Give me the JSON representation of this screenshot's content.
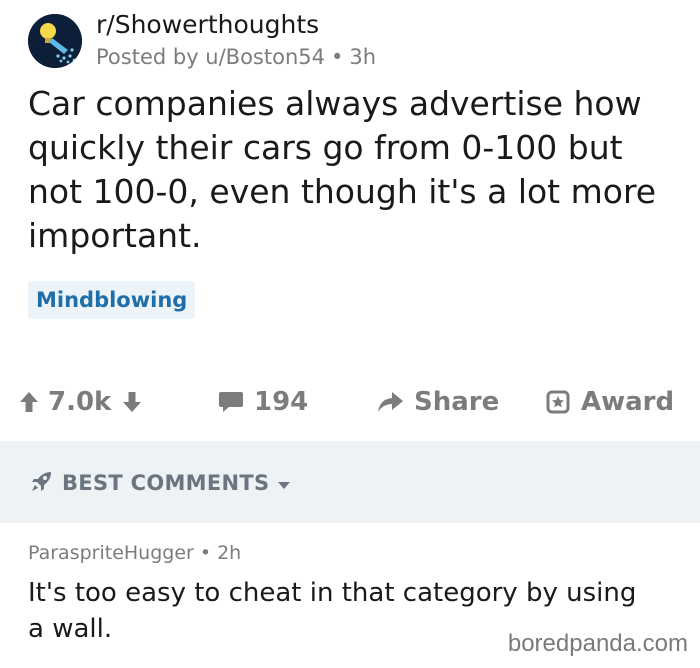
{
  "post": {
    "subreddit": "r/Showerthoughts",
    "posted_by": "Posted by u/Boston54",
    "separator": "•",
    "age": "3h",
    "title": "Car companies always advertise how quickly their cars go from 0-100 but not 100-0, even though it's a lot more important.",
    "flair": "Mindblowing",
    "avatar_icon": "lightbulb-shower-icon"
  },
  "actions": {
    "votes": "7.0k",
    "comments_count": "194",
    "share_label": "Share",
    "award_label": "Award"
  },
  "sort": {
    "label": "BEST COMMENTS"
  },
  "comment": {
    "author": "ParaspriteHugger",
    "separator": "•",
    "age": "2h",
    "body": "It's too easy to cheat in that category by using a wall."
  },
  "watermark": "boredpanda.com",
  "colors": {
    "flair_text": "#1f6ea8",
    "flair_bg": "#edf4f9",
    "meta_gray": "#7c7c7c",
    "sort_bar_bg": "#eff2f5"
  }
}
